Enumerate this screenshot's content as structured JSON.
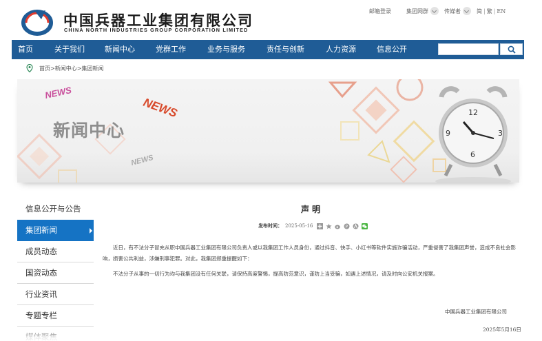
{
  "header": {
    "brand_cn": "中国兵器工业集团有限公司",
    "brand_en": "CHINA NORTH INDUSTRIES GROUP CORPORATION LIMITED",
    "top_links": {
      "mail": "邮箱登录",
      "group_site": "集团网群",
      "media": "传媒者",
      "lang_simplified": "简",
      "lang_traditional": "繁",
      "lang_english": "EN"
    }
  },
  "nav": {
    "items": [
      "首页",
      "关于我们",
      "新闻中心",
      "党群工作",
      "业务与服务",
      "责任与创新",
      "人力资源",
      "信息公开"
    ],
    "search_placeholder": ""
  },
  "breadcrumb": {
    "home": "首页",
    "news": "新闻中心",
    "current": "集团新闻",
    "separator": ">"
  },
  "banner": {
    "title": "新闻中心",
    "tags": [
      "NEWS",
      "NEWS",
      "NEWS"
    ]
  },
  "sidebar": {
    "items": [
      "信息公开与公告",
      "集团新闻",
      "成员动态",
      "国资动态",
      "行业资讯",
      "专题专栏",
      "媒体聚焦"
    ],
    "active_index": 1
  },
  "article": {
    "title": "声明",
    "publish_label": "发布时间：",
    "publish_date": "2025-05-16",
    "para1": "近日，有不法分子冒充从职中国兵器工业集团有限公司负责人或以我集团工作人员身份，通过抖音、快手、小红书等软件实施诈骗活动，严重侵害了我集团声誉，造成不良社会影响，损害公共利益，涉嫌刑事犯罪。对此，我集团郑重提醒如下：",
    "para2": "不法分子从事的一切行为均与我集团没有任何关联，请保持高度警惕，提高防范意识，谨防上当受骗，如遇上述情况，请及时向公安机关报案。",
    "signature": "中国兵器工业集团有限公司",
    "sign_date": "2025年5月16日"
  },
  "colors": {
    "nav_bg": "#1f5c96",
    "sidebar_active": "#1573c4",
    "news_tag": "#d84a2b"
  }
}
